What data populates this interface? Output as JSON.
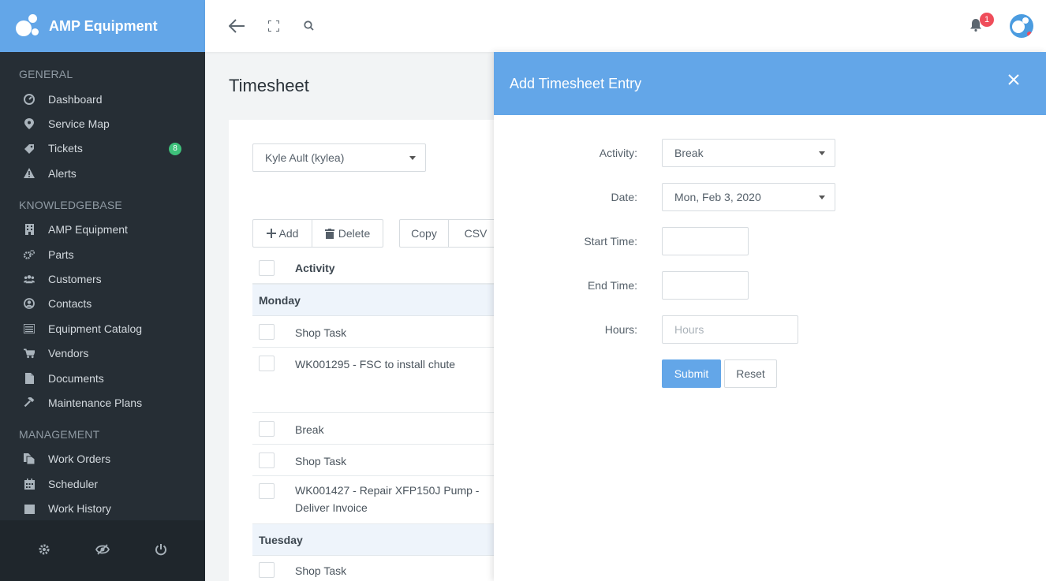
{
  "brand": {
    "title": "AMP Equipment"
  },
  "sidebar": {
    "sections": [
      {
        "title": "GENERAL",
        "items": [
          {
            "label": "Dashboard",
            "icon": "dashboard-icon"
          },
          {
            "label": "Service Map",
            "icon": "map-pin-icon"
          },
          {
            "label": "Tickets",
            "icon": "ticket-icon",
            "badge": "8"
          },
          {
            "label": "Alerts",
            "icon": "warning-icon"
          }
        ]
      },
      {
        "title": "KNOWLEDGEBASE",
        "items": [
          {
            "label": "AMP Equipment",
            "icon": "building-icon"
          },
          {
            "label": "Parts",
            "icon": "cogs-icon"
          },
          {
            "label": "Customers",
            "icon": "users-icon"
          },
          {
            "label": "Contacts",
            "icon": "contact-icon"
          },
          {
            "label": "Equipment Catalog",
            "icon": "catalog-icon"
          },
          {
            "label": "Vendors",
            "icon": "cart-icon"
          },
          {
            "label": "Documents",
            "icon": "document-icon"
          },
          {
            "label": "Maintenance Plans",
            "icon": "hammer-icon"
          }
        ]
      },
      {
        "title": "MANAGEMENT",
        "items": [
          {
            "label": "Work Orders",
            "icon": "files-icon"
          },
          {
            "label": "Scheduler",
            "icon": "calendar-icon"
          },
          {
            "label": "Work History",
            "icon": "calendar-icon"
          }
        ]
      }
    ]
  },
  "page": {
    "title": "Timesheet"
  },
  "user_select": {
    "value": "Kyle Ault (kylea)"
  },
  "toolbar": {
    "add": "Add",
    "delete": "Delete",
    "copy": "Copy",
    "csv": "CSV"
  },
  "table": {
    "header": "Activity",
    "groups": [
      {
        "day": "Monday",
        "rows": [
          "Shop Task",
          "WK001295 - FSC to install chute",
          "Break",
          "Shop Task",
          "WK001427 - Repair XFP150J Pump - Deliver Invoice"
        ]
      },
      {
        "day": "Tuesday",
        "rows": [
          "Shop Task"
        ]
      }
    ]
  },
  "notifications": {
    "count": "1"
  },
  "panel": {
    "title": "Add Timesheet Entry",
    "activity": {
      "label": "Activity:",
      "value": "Break"
    },
    "date": {
      "label": "Date:",
      "value": "Mon, Feb 3, 2020"
    },
    "start_time": {
      "label": "Start Time:",
      "value": ""
    },
    "end_time": {
      "label": "End Time:",
      "value": ""
    },
    "hours": {
      "label": "Hours:",
      "placeholder": "Hours"
    },
    "submit": "Submit",
    "reset": "Reset"
  },
  "colors": {
    "accent": "#63a6e8",
    "sidebar": "#262e35",
    "badge_green": "#3ec17b",
    "badge_red": "#ef4d5a"
  }
}
